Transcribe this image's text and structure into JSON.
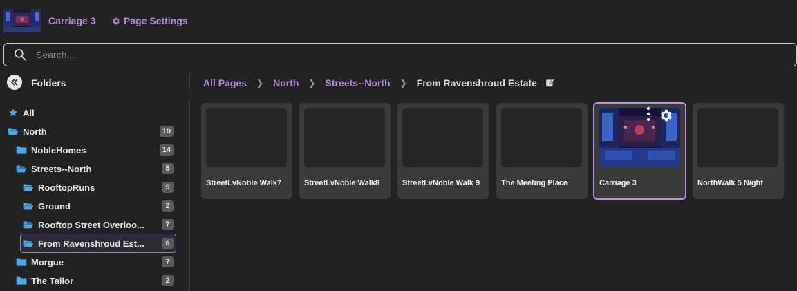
{
  "header": {
    "title": "Carriage 3",
    "settings_label": "Page Settings"
  },
  "search": {
    "placeholder": "Search..."
  },
  "sidebar": {
    "heading": "Folders",
    "items": [
      {
        "label": "All",
        "count": "",
        "icon": "star-icon"
      },
      {
        "label": "North",
        "count": "19",
        "icon": "folder-open-icon"
      },
      {
        "label": "NobleHomes",
        "count": "14",
        "icon": "folder-icon"
      },
      {
        "label": "Streets--North",
        "count": "5",
        "icon": "folder-open-icon"
      },
      {
        "label": "RooftopRuns",
        "count": "9",
        "icon": "folder-open-icon"
      },
      {
        "label": "Ground",
        "count": "2",
        "icon": "folder-open-icon"
      },
      {
        "label": "Rooftop Street Overloo...",
        "count": "7",
        "icon": "folder-open-icon"
      },
      {
        "label": "From Ravenshroud Est...",
        "count": "6",
        "icon": "folder-open-icon"
      },
      {
        "label": "Morgue",
        "count": "7",
        "icon": "folder-icon"
      },
      {
        "label": "The Tailor",
        "count": "2",
        "icon": "folder-icon"
      }
    ]
  },
  "breadcrumb": {
    "items": [
      "All Pages",
      "North",
      "Streets--North"
    ],
    "current": "From Ravenshroud Estate"
  },
  "cards": [
    {
      "name": "StreetLvNoble Walk7"
    },
    {
      "name": "StreetLvNoble Walk8"
    },
    {
      "name": "StreetLvNoble Walk 9"
    },
    {
      "name": "The Meeting Place"
    },
    {
      "name": "Carriage 3"
    },
    {
      "name": "NorthWalk 5 Night"
    }
  ],
  "colors": {
    "accent": "#b48bd6",
    "folder": "#4aa8e8",
    "background": "#222222"
  }
}
